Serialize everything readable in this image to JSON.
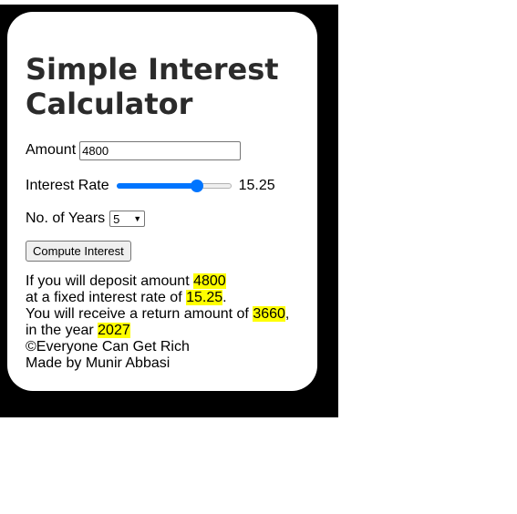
{
  "title": "Simple Interest Calculator",
  "form": {
    "amount_label": "Amount",
    "amount_value": "4800",
    "rate_label": "Interest Rate",
    "rate_value": "15.25",
    "rate_fraction": 0.728,
    "years_label": "No. of Years",
    "years_value": "5",
    "compute_label": "Compute Interest"
  },
  "result": {
    "line1_prefix": "If you will deposit amount ",
    "amount": "4800",
    "line2_prefix": "at a fixed interest rate of ",
    "rate": "15.25",
    "line2_suffix": ".",
    "line3_prefix": "You will receive a return amount of ",
    "return_amount": "3660",
    "line3_suffix": ",",
    "line4_prefix": "in the year ",
    "year": "2027",
    "copyright": "©Everyone Can Get Rich",
    "credit": "Made by Munir Abbasi"
  },
  "colors": {
    "highlight": "#ffff00",
    "accent": "#0075ff",
    "backdrop": "#000000"
  }
}
